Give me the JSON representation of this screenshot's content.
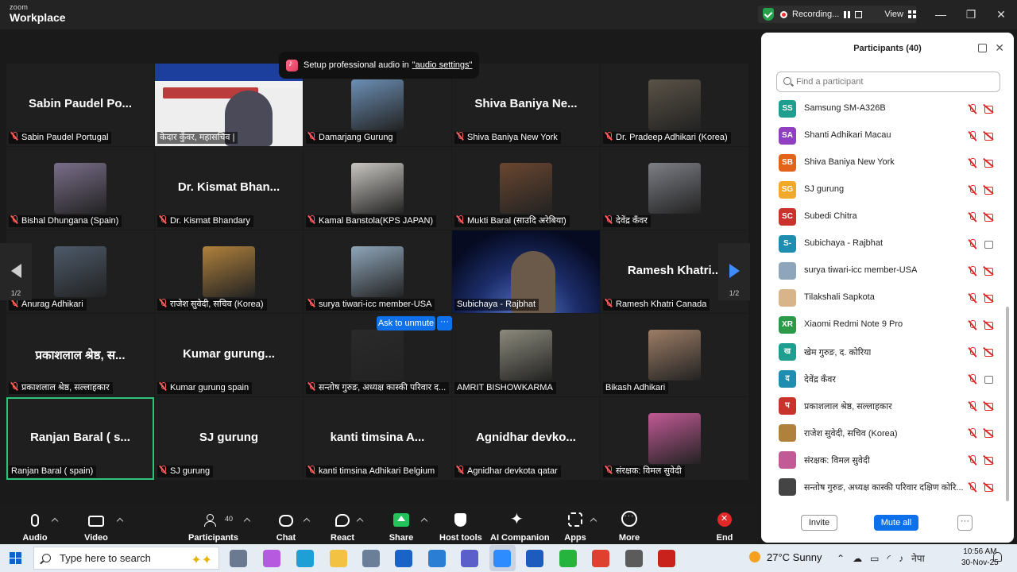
{
  "brand": {
    "top": "zoom",
    "bottom": "Workplace"
  },
  "recording": {
    "label": "Recording...",
    "view_label": "View"
  },
  "window": {
    "minimize": "—",
    "restore": "❐",
    "close": "✕"
  },
  "toast": {
    "text": "Setup professional audio in",
    "link": "\"audio settings\""
  },
  "tiles": [
    {
      "big": "Sabin Paudel Po...",
      "label": "Sabin Paudel Portugal",
      "mic_off": true
    },
    {
      "big": "",
      "label": "केदार कुँवर, महासचिव |",
      "mic_off": false,
      "type": "poster"
    },
    {
      "big": "",
      "label": "Damarjang Gurung",
      "mic_off": true,
      "photo": "#6c8fb5"
    },
    {
      "big": "Shiva Baniya Ne...",
      "label": "Shiva Baniya New York",
      "mic_off": true
    },
    {
      "big": "",
      "label": "Dr. Pradeep Adhikari (Korea)",
      "mic_off": true,
      "photo": "#5a5246"
    },
    {
      "big": "",
      "label": "Bishal Dhungana (Spain)",
      "mic_off": true,
      "photo": "#7a6e8a"
    },
    {
      "big": "Dr. Kismat Bhan...",
      "label": "Dr. Kismat Bhandary",
      "mic_off": true
    },
    {
      "big": "",
      "label": "Kamal Banstola(KPS JAPAN)",
      "mic_off": true,
      "photo": "#c9c6c1"
    },
    {
      "big": "",
      "label": "Mukti Baral (साउदि अरेबिया)",
      "mic_off": true,
      "photo": "#6a4630"
    },
    {
      "big": "",
      "label": "देवेंद्र कँवर",
      "mic_off": true,
      "photo": "#7d7f86"
    },
    {
      "big": "",
      "label": "Anurag Adhikari",
      "mic_off": true,
      "photo": "#4d5a6a"
    },
    {
      "big": "",
      "label": "राजेश सुवेदी, सचिव (Korea)",
      "mic_off": true,
      "photo": "#b0813c"
    },
    {
      "big": "",
      "label": "surya tiwari-icc member-USA",
      "mic_off": true,
      "photo": "#8fa6ba"
    },
    {
      "big": "",
      "label": "Subichaya - Rajbhat",
      "mic_off": false,
      "type": "space"
    },
    {
      "big": "Ramesh Khatri...",
      "label": "Ramesh Khatri Canada",
      "mic_off": true
    },
    {
      "big": "प्रकाशलाल श्रेष्ठ, स...",
      "label": "प्रकाशलाल श्रेष्ठ, सल्लाहकार",
      "mic_off": true
    },
    {
      "big": "Kumar gurung...",
      "label": "Kumar gurung  spain",
      "mic_off": true
    },
    {
      "big": "",
      "label": "सन्तोष गुरुङ, अध्यक्ष कास्की परिवार द...",
      "mic_off": true,
      "photo": "#2a2a2a"
    },
    {
      "big": "",
      "label": "AMRIT BISHOWKARMA",
      "mic_off": false,
      "photo": "#8c8a7c"
    },
    {
      "big": "",
      "label": "Bikash Adhikari",
      "mic_off": false,
      "photo": "#9d7d66"
    },
    {
      "big": "Ranjan Baral ( s...",
      "label": "Ranjan Baral ( spain)",
      "mic_off": false,
      "active": true
    },
    {
      "big": "SJ gurung",
      "label": "SJ gurung",
      "mic_off": true
    },
    {
      "big": "kanti timsina A...",
      "label": "kanti timsina Adhikari Belgium",
      "mic_off": true
    },
    {
      "big": "Agnidhar devko...",
      "label": "Agnidhar devkota qatar",
      "mic_off": true
    },
    {
      "big": "",
      "label": "संरक्षक: विमल सुवेदी",
      "mic_off": true,
      "photo": "#c25a96"
    }
  ],
  "pager": {
    "left": "1/2",
    "right": "1/2"
  },
  "ask_to_unmute": "Ask to unmute",
  "ask_more": "···",
  "panel": {
    "title": "Participants (40)",
    "search_placeholder": "Find a participant",
    "invite": "Invite",
    "mute_all": "Mute all",
    "more": "···",
    "participants": [
      {
        "initials": "SS",
        "color": "#1f9e8f",
        "name": "Samsung SM-A326B",
        "cam_on": false
      },
      {
        "initials": "SA",
        "color": "#8f3fbf",
        "name": "Shanti Adhikari Macau",
        "cam_on": false
      },
      {
        "initials": "SB",
        "color": "#e2641b",
        "name": "Shiva Baniya New York",
        "cam_on": false
      },
      {
        "initials": "SG",
        "color": "#f1a929",
        "name": "SJ gurung",
        "cam_on": false
      },
      {
        "initials": "SC",
        "color": "#c9332c",
        "name": "Subedi Chitra",
        "cam_on": false
      },
      {
        "initials": "S-",
        "color": "#1e8db0",
        "name": "Subichaya - Rajbhat",
        "cam_on": true
      },
      {
        "initials": "",
        "color": "#8fa6ba",
        "name": "surya tiwari-icc member-USA",
        "cam_on": false
      },
      {
        "initials": "",
        "color": "#d7b48a",
        "name": "Tilakshali Sapkota",
        "cam_on": false
      },
      {
        "initials": "XR",
        "color": "#2d9a4a",
        "name": "Xiaomi Redmi Note 9 Pro",
        "cam_on": false
      },
      {
        "initials": "ख",
        "color": "#1f9e8f",
        "name": "खेम गुरुङ, द. कोरिया",
        "cam_on": false
      },
      {
        "initials": "द",
        "color": "#1e8db0",
        "name": "देवेंद्र कँवर",
        "cam_on": true
      },
      {
        "initials": "प",
        "color": "#c9332c",
        "name": "प्रकाशलाल श्रेष्ठ, सल्लाहकार",
        "cam_on": false
      },
      {
        "initials": "",
        "color": "#b0813c",
        "name": "राजेश सुवेदी, सचिव (Korea)",
        "cam_on": false
      },
      {
        "initials": "",
        "color": "#c25a96",
        "name": "संरक्षक: विमल सुवेदी",
        "cam_on": false
      },
      {
        "initials": "",
        "color": "#444444",
        "name": "सन्तोष गुरुङ, अध्यक्ष कास्की परिवार दक्षिण कोरि...",
        "cam_on": false
      }
    ]
  },
  "toolbar": {
    "audio": "Audio",
    "video": "Video",
    "participants": "Participants",
    "participants_count": "40",
    "chat": "Chat",
    "react": "React",
    "share": "Share",
    "host_tools": "Host tools",
    "ai_companion": "AI Companion",
    "apps": "Apps",
    "more": "More",
    "end": "End"
  },
  "taskbar": {
    "search_placeholder": "Type here to search",
    "weather": "27°C  Sunny",
    "lang": "नेपा",
    "time": "10:56 AM",
    "date": "30-Nov-25",
    "apps": [
      {
        "name": "task-view-icon",
        "color": "#6b7a90"
      },
      {
        "name": "copilot-icon",
        "color": "#b65be0"
      },
      {
        "name": "edge-icon",
        "color": "#1e9fd6"
      },
      {
        "name": "file-explorer-icon",
        "color": "#f2c342"
      },
      {
        "name": "mail-icon",
        "color": "#6b7f99"
      },
      {
        "name": "outlook-icon",
        "color": "#1a64c8"
      },
      {
        "name": "ie-icon",
        "color": "#2a7fd4"
      },
      {
        "name": "teams-icon",
        "color": "#5a5fc9"
      },
      {
        "name": "zoom-icon",
        "color": "#2d8cff"
      },
      {
        "name": "word-icon",
        "color": "#1d5bbf"
      },
      {
        "name": "whatsapp-icon",
        "color": "#27b43e"
      },
      {
        "name": "chrome-icon",
        "color": "#e0402f"
      },
      {
        "name": "settings-icon",
        "color": "#5b5b5b"
      },
      {
        "name": "acrobat-icon",
        "color": "#c9221d"
      }
    ]
  }
}
